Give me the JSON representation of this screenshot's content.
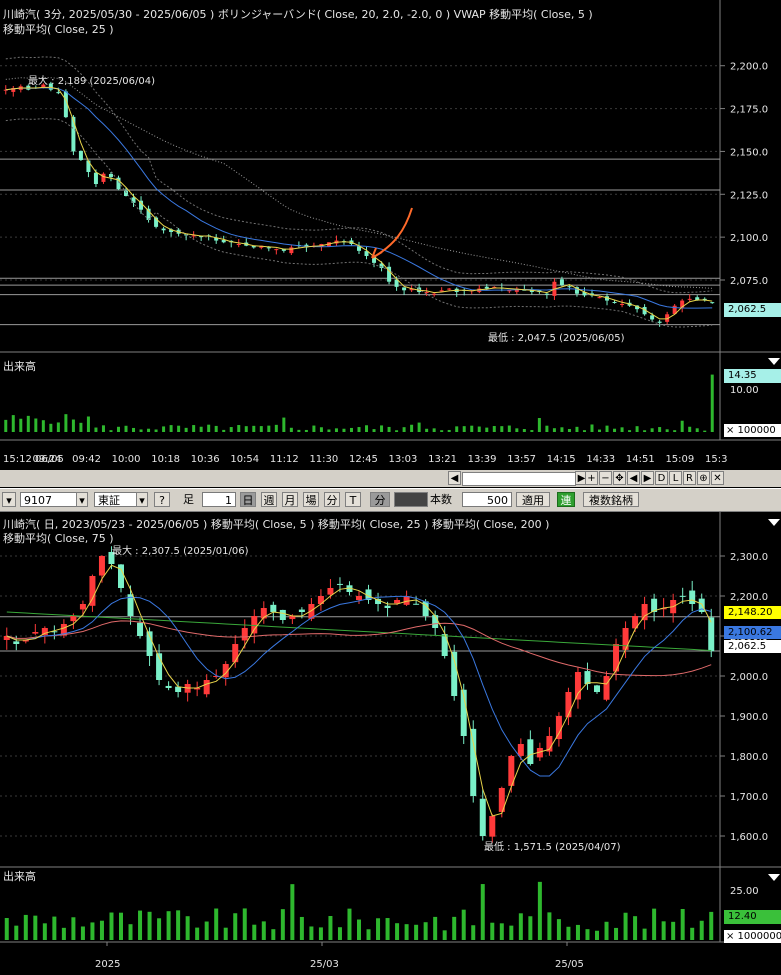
{
  "intraday": {
    "header_line1": "川崎汽( 3分, 2025/05/30 - 2025/06/05 )   ボリンジャーバンド( Close, 20, 2.0, -2.0, 0 )   VWAP   移動平均( Close, 5 )",
    "header_line2": "移動平均( Close, 25 )",
    "max_label": "最大 : 2,189 (2025/06/04)",
    "min_label": "最低 : 2,047.5 (2025/06/05)",
    "current_price_label": "2,062.5",
    "volume_title": "出来高",
    "volume_value_label": "14.35",
    "volume_tick": "10.00",
    "volume_unit": "× 100000",
    "time_labels": [
      "15:12 06/05",
      "09:24",
      "09:42",
      "10:00",
      "10:18",
      "10:36",
      "10:54",
      "11:12",
      "11:30",
      "12:45",
      "13:03",
      "13:21",
      "13:39",
      "13:57",
      "14:15",
      "14:33",
      "14:51",
      "15:09",
      "15:3"
    ]
  },
  "daily": {
    "header_line1": "川崎汽( 日, 2023/05/23 - 2025/06/05 )   移動平均( Close, 5 )   移動平均( Close, 25 )   移動平均( Close, 200 )",
    "header_line2": "移動平均( Close, 75 )",
    "max_label": "最大 : 2,307.5 (2025/01/06)",
    "min_label": "最低 : 1,571.5 (2025/04/07)",
    "price_labels": {
      "yellow": "2,148.20",
      "blue": "2,100.62",
      "white": "2,062.5"
    },
    "volume_title": "出来高",
    "volume_value_label": "12.40",
    "volume_tick": "25.00",
    "volume_unit": "× 1000000",
    "date_labels": [
      "2025",
      "25/03",
      "25/05"
    ]
  },
  "toolbar": {
    "code": "9107",
    "market": "東証",
    "help": "?",
    "ashi_label": "足",
    "ashi_value": "1",
    "day": "日",
    "week": "週",
    "month": "月",
    "ba": "場",
    "bun": "分",
    "t": "T",
    "bun2": "分",
    "honsu_label": "本数",
    "honsu_value": "500",
    "apply": "適用",
    "ren": "連",
    "multi": "複数銘柄"
  },
  "scroll_buttons": [
    "+",
    "−",
    "✥",
    "◀",
    "▶",
    "D",
    "L",
    "R",
    "⊕",
    "✕"
  ],
  "chart_data": [
    {
      "type": "candlestick",
      "title": "川崎汽( 3分, 2025/05/30 - 2025/06/05 )",
      "ylim": [
        2040,
        2215
      ],
      "y_ticks": [
        2200,
        2175,
        2150,
        2125,
        2100,
        2075
      ],
      "y_tick_labels": [
        "2,200.0",
        "2,175.0",
        "2,150.0",
        "2,125.0",
        "2,100.0",
        "2,075.0"
      ],
      "horizontal_lines": [
        2145.5,
        2127.5,
        2076,
        2072,
        2066.5,
        2049
      ],
      "closes": [
        2186,
        2187,
        2188,
        2186,
        2187,
        2189,
        2186,
        2184,
        2170,
        2150,
        2145,
        2138,
        2131,
        2137,
        2135,
        2128,
        2124,
        2120,
        2116,
        2110,
        2106,
        2104,
        2103,
        2102,
        2101,
        2101,
        2100,
        2101,
        2098,
        2097,
        2097,
        2096,
        2095,
        2094,
        2095,
        2094,
        2093,
        2092,
        2094,
        2095,
        2094,
        2095,
        2096,
        2097,
        2098,
        2097,
        2096,
        2092,
        2089,
        2085,
        2082,
        2074,
        2071,
        2069,
        2070,
        2068,
        2068,
        2067,
        2069,
        2070,
        2068,
        2069,
        2069,
        2070,
        2070,
        2071,
        2070,
        2069,
        2070,
        2069,
        2068,
        2068,
        2067,
        2074,
        2072,
        2071,
        2067,
        2066,
        2066,
        2065,
        2063,
        2062,
        2061,
        2060,
        2058,
        2055,
        2052,
        2050,
        2055,
        2060,
        2063,
        2064,
        2063,
        2063,
        2062
      ],
      "series": [
        {
          "name": "移動平均( Close, 5 )",
          "color": "#e8d44a"
        },
        {
          "name": "移動平均( Close, 25 )",
          "color": "#3a78e0"
        },
        {
          "name": "VWAP",
          "color": "#9a9a9a"
        },
        {
          "name": "ボリンジャーバンド( Close, 20, 2.0, -2.0, 0 )",
          "color": "#707070"
        }
      ],
      "volume_max": 14.35
    },
    {
      "type": "candlestick",
      "title": "川崎汽( 日, 2023/05/23 - 2025/06/05 )",
      "ylim": [
        1560,
        2340
      ],
      "y_ticks": [
        2300,
        2200,
        2100,
        2000,
        1900,
        1800,
        1700,
        1600
      ],
      "y_tick_labels": [
        "2,300.0",
        "2,200.0",
        "2,100.0",
        "2,000.0",
        "1,900.0",
        "1,800.0",
        "1,700.0",
        "1,600.0"
      ],
      "horizontal_lines": [
        2148.2,
        2062.5
      ],
      "closes": [
        2100,
        2080,
        2090,
        2110,
        2120,
        2110,
        2130,
        2150,
        2180,
        2250,
        2300,
        2280,
        2220,
        2150,
        2100,
        2050,
        1990,
        1970,
        1960,
        1980,
        1970,
        1990,
        2000,
        2030,
        2080,
        2120,
        2150,
        2170,
        2160,
        2140,
        2150,
        2160,
        2180,
        2200,
        2220,
        2230,
        2210,
        2200,
        2190,
        2180,
        2170,
        2190,
        2200,
        2180,
        2150,
        2120,
        2050,
        1950,
        1850,
        1700,
        1600,
        1650,
        1720,
        1800,
        1830,
        1780,
        1820,
        1850,
        1900,
        1960,
        2010,
        1980,
        1960,
        2000,
        2080,
        2120,
        2150,
        2180,
        2160,
        2170,
        2190,
        2200,
        2180,
        2160,
        2062
      ],
      "series": [
        {
          "name": "移動平均( Close, 5 )",
          "color": "#e8d44a"
        },
        {
          "name": "移動平均( Close, 25 )",
          "color": "#3a78e0"
        },
        {
          "name": "移動平均( Close, 75 )",
          "color": "#e06a6a"
        },
        {
          "name": "移動平均( Close, 200 )",
          "color": "#3aa83a"
        }
      ],
      "volume_max": 25
    }
  ]
}
